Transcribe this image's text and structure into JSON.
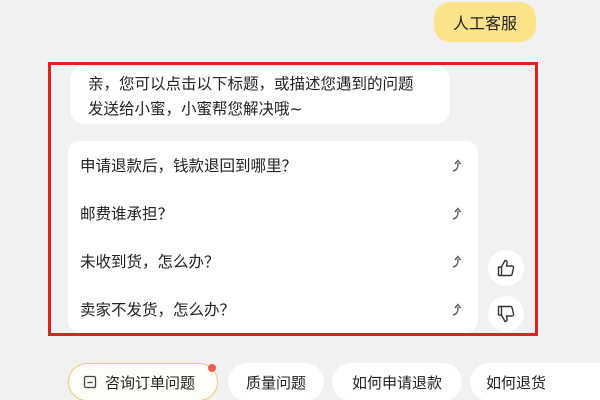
{
  "outgoing_message": {
    "text": "人工客服"
  },
  "greeting": {
    "line1": "亲，您可以点击以下标题，或描述您遇到的问题",
    "line2": "发送给小蜜，小蜜帮您解决哦~"
  },
  "questions": [
    {
      "text": "申请退款后，钱款退回到哪里？",
      "icon": "share-arrow-icon"
    },
    {
      "text": "邮费谁承担？",
      "icon": "share-arrow-icon"
    },
    {
      "text": "未收到货，怎么办？",
      "icon": "share-arrow-icon"
    },
    {
      "text": "卖家不发货，怎么办？",
      "icon": "share-arrow-icon"
    }
  ],
  "feedback": {
    "like_icon": "thumbs-up-icon",
    "dislike_icon": "thumbs-down-icon"
  },
  "chips": [
    {
      "label": "咨询订单问题",
      "icon": "order-icon",
      "has_dot": true
    },
    {
      "label": "质量问题"
    },
    {
      "label": "如何申请退款"
    },
    {
      "label": "如何退货"
    }
  ],
  "colors": {
    "user_bubble": "#fce28a",
    "highlight_border": "#e0211b",
    "background": "#f1f1f1",
    "notification_dot": "#ef5b4c"
  }
}
